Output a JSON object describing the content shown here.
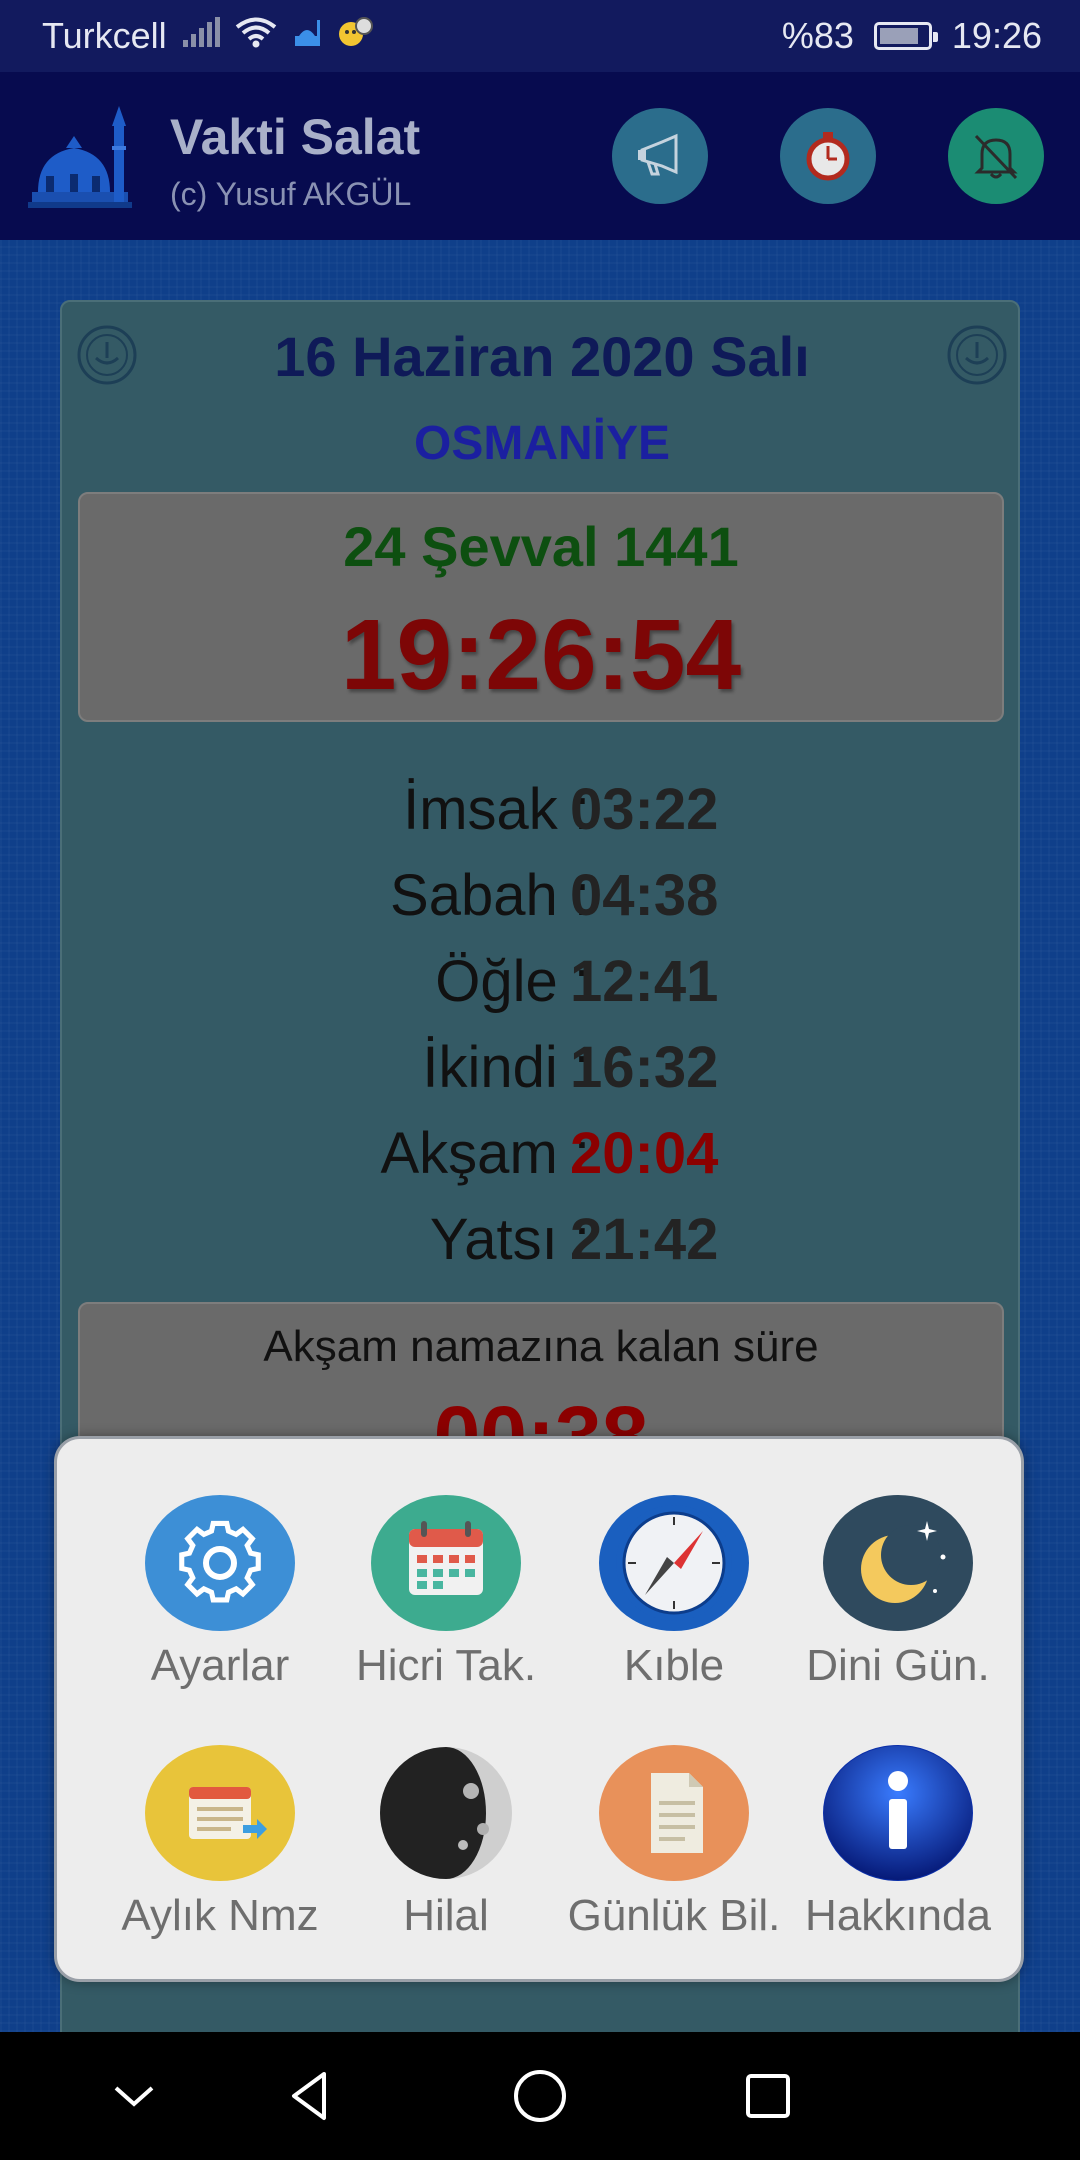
{
  "status_bar": {
    "carrier": "Turkcell",
    "battery_percent": "%83",
    "battery_level": 0.83,
    "time": "19:26"
  },
  "app_bar": {
    "title": "Vakti Salat",
    "subtitle": "(c) Yusuf AKGÜL",
    "buttons": [
      "megaphone-icon",
      "timer-icon",
      "bell-off-icon"
    ]
  },
  "card": {
    "date": "16 Haziran 2020 Salı",
    "city": "OSMANİYE",
    "hijri_date": "24 Şevval 1441",
    "clock": "19:26:54",
    "prayer_times": [
      {
        "name": "İmsak :",
        "time": "03:22"
      },
      {
        "name": "Sabah :",
        "time": "04:38"
      },
      {
        "name": "Öğle :",
        "time": "12:41"
      },
      {
        "name": "İkindi :",
        "time": "16:32"
      },
      {
        "name": "Akşam :",
        "time": "20:04"
      },
      {
        "name": "Yatsı :",
        "time": "21:42"
      }
    ],
    "remaining_label": "Akşam namazına kalan süre",
    "remaining_value": "00:38"
  },
  "menu": {
    "items": [
      {
        "label": "Ayarlar",
        "icon": "gear-icon",
        "color": "#3d8fd6"
      },
      {
        "label": "Hicri Tak.",
        "icon": "calendar-icon",
        "color": "#3dab8f"
      },
      {
        "label": "Kıble",
        "icon": "compass-icon",
        "color": "#1a5fbf"
      },
      {
        "label": "Dini Gün.",
        "icon": "crescent-moon-icon",
        "color": "#2f4a5e"
      },
      {
        "label": "Aylık Nmz",
        "icon": "monthly-calendar-icon",
        "color": "#e8c43a"
      },
      {
        "label": "Hilal",
        "icon": "moon-phase-icon",
        "color": "#5a5a5a"
      },
      {
        "label": "Günlük Bil.",
        "icon": "document-icon",
        "color": "#e8915a"
      },
      {
        "label": "Hakkında",
        "icon": "info-icon",
        "color": "#0a2ea8"
      }
    ]
  },
  "colors": {
    "status_bar_bg": "#121a5e",
    "app_bar_bg": "#070b4f",
    "card_bg": "#345a65",
    "next_prayer": "#8b0000",
    "hijri": "#0d4f10"
  }
}
